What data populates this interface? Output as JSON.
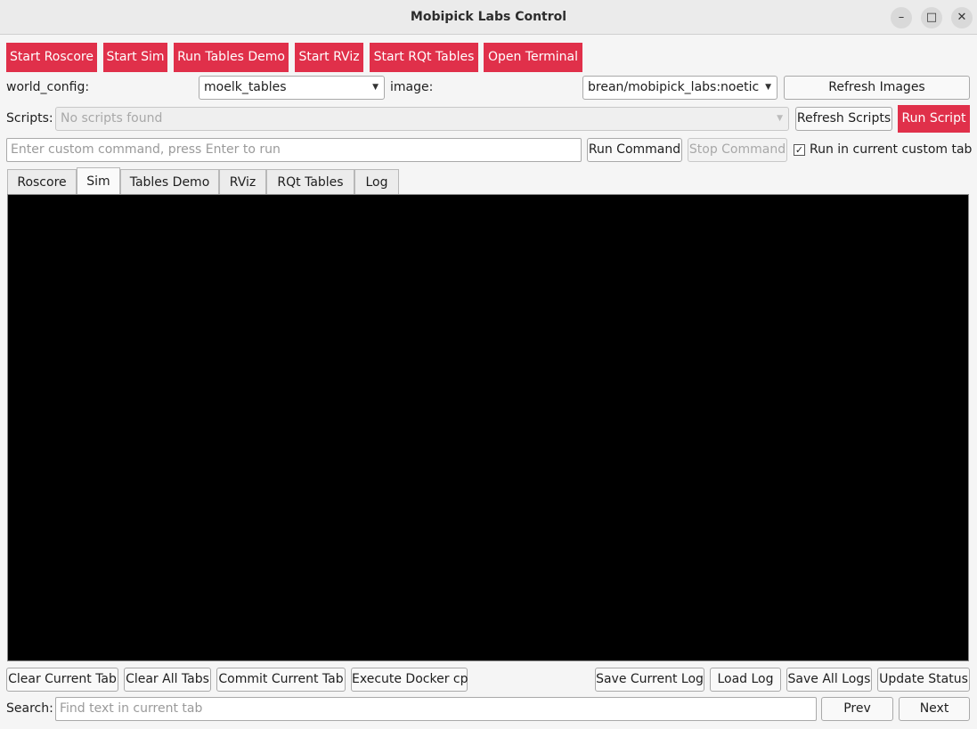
{
  "window": {
    "title": "Mobipick Labs Control",
    "minimize_glyph": "–",
    "maximize_glyph": "□",
    "close_glyph": "✕"
  },
  "toolbar": {
    "start_roscore": "Start Roscore",
    "start_sim": "Start Sim",
    "run_tables_demo": "Run Tables Demo",
    "start_rviz": "Start RViz",
    "start_rqt_tables": "Start RQt Tables",
    "open_terminal": "Open Terminal",
    "accent_color": "#e0304a"
  },
  "config": {
    "world_config_label": "world_config:",
    "world_config_value": "moelk_tables",
    "image_label": "image:",
    "image_value": "brean/mobipick_labs:noetic",
    "refresh_images": "Refresh Images"
  },
  "scripts": {
    "label": "Scripts:",
    "value": "No scripts found",
    "refresh_scripts": "Refresh Scripts",
    "run_script": "Run Script"
  },
  "command": {
    "placeholder": "Enter custom command, press Enter to run",
    "run_command": "Run Command",
    "stop_command": "Stop Command",
    "run_in_current_tab": "Run in current custom tab",
    "run_in_current_tab_checked": true,
    "check_glyph": "✓"
  },
  "tabs": {
    "items": [
      "Roscore",
      "Sim",
      "Tables Demo",
      "RViz",
      "RQt Tables",
      "Log"
    ],
    "active": "Sim"
  },
  "bottom": {
    "clear_current_tab": "Clear Current Tab",
    "clear_all_tabs": "Clear All Tabs",
    "commit_current_tab": "Commit Current Tab",
    "execute_docker_cp": "Execute Docker cp",
    "save_current_log": "Save Current Log",
    "load_log": "Load Log",
    "save_all_logs": "Save All Logs",
    "update_status": "Update Status"
  },
  "search": {
    "label": "Search:",
    "placeholder": "Find text in current tab",
    "prev": "Prev",
    "next": "Next"
  },
  "dropdown_icon": "▼"
}
